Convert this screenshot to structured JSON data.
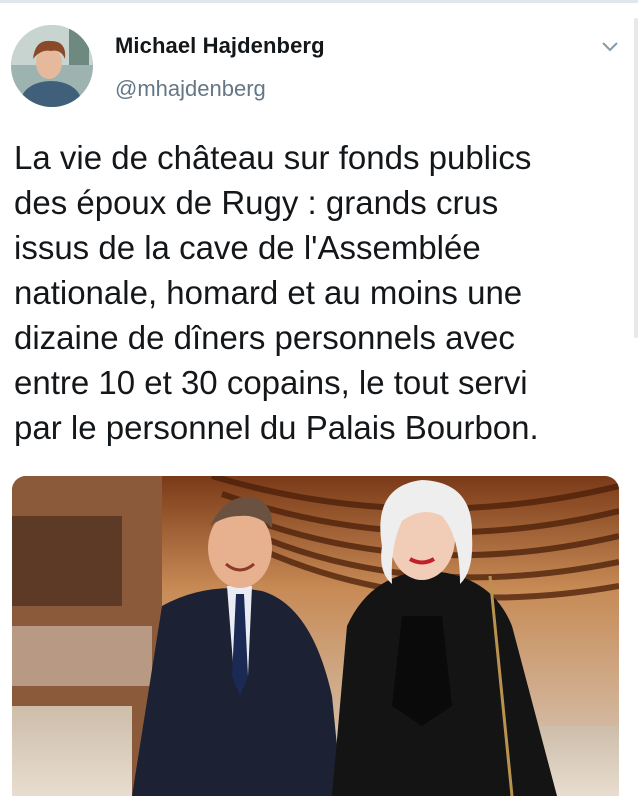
{
  "tweet": {
    "author_name": "Michael Hajdenberg",
    "author_handle": "@mhajdenberg",
    "text": "La vie de château sur fonds publics\ndes époux de Rugy : grands crus\nissus de la cave de l'Assemblée\nnationale, homard et au moins une\ndizaine de dîners personnels avec\nentre 10 et 30 copains, le tout servi\npar le personnel du Palais Bourbon.",
    "menu_icon": "chevron-down-icon",
    "media_alt": ""
  },
  "colors": {
    "name": "#14171a",
    "handle": "#657786",
    "text": "#14171a",
    "border": "#e1e8ed"
  }
}
